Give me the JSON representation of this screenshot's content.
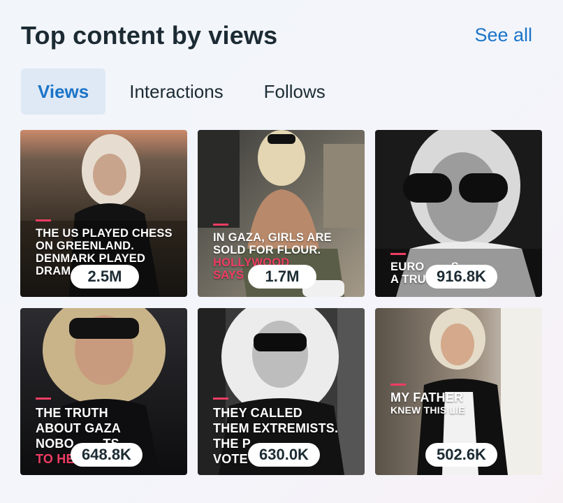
{
  "header": {
    "title": "Top content by views",
    "see_all": "See all"
  },
  "tabs": [
    {
      "label": "Views",
      "active": true
    },
    {
      "label": "Interactions",
      "active": false
    },
    {
      "label": "Follows",
      "active": false
    }
  ],
  "posts": [
    {
      "caption": [
        "THE US PLAYED CHESS",
        "ON GREENLAND.",
        "DENMARK PLAYED",
        "DRAM"
      ],
      "pink_line": "",
      "views": "2.5M"
    },
    {
      "caption": [
        "IN GAZA, GIRLS ARE",
        "SOLD FOR FLOUR."
      ],
      "pink_line": [
        "HOLLYWOOD",
        "SAYS"
      ],
      "views": "1.7M"
    },
    {
      "caption": [
        "EURO        S",
        "A TRUMP"
      ],
      "pink_line": "",
      "views": "916.8K"
    },
    {
      "caption": [
        "THE TRUTH",
        "ABOUT GAZA",
        "NOBO        TS"
      ],
      "pink_line": "TO HE",
      "views": "648.8K"
    },
    {
      "caption": [
        "THEY CALLED",
        "THEM EXTREMISTS.",
        "THE P",
        "VOTE"
      ],
      "pink_line": "",
      "views": "630.0K"
    },
    {
      "caption": [
        "MY FATHER",
        "KNEW THIS LIE"
      ],
      "pink_line": "",
      "views": "502.6K"
    }
  ],
  "colors": {
    "accent": "#1b74c8",
    "active_tab_bg": "#dfe9f5",
    "caption_pink": "#ef3d63",
    "text": "#1c2b33"
  },
  "icons": [
    "photo-thumbnail"
  ]
}
